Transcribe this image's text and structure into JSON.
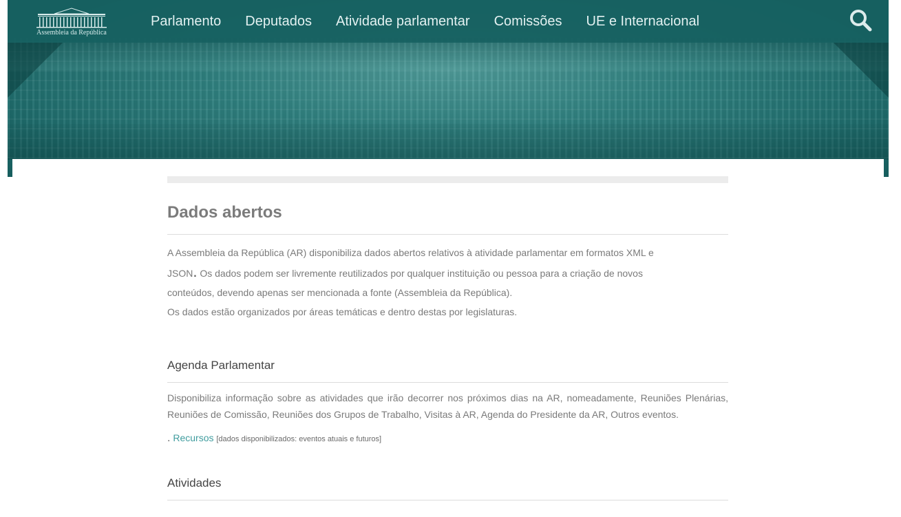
{
  "header": {
    "logo_text": "Assembleia da República",
    "nav": [
      {
        "label": "Parlamento"
      },
      {
        "label": "Deputados"
      },
      {
        "label": "Atividade parlamentar"
      },
      {
        "label": "Comissões"
      },
      {
        "label": "UE e Internacional"
      }
    ],
    "search_icon": "search-icon"
  },
  "colors": {
    "nav_bg": "#166060",
    "accent": "#3f9c9e",
    "title_grey": "#7b7b7b"
  },
  "main": {
    "title": "Dados abertos",
    "intro_line1": "A Assembleia da República (AR) disponibiliza dados abertos relativos à atividade parlamentar em formatos XML e",
    "intro_line2a": "JSON",
    "intro_dot": ".",
    "intro_line2b": " Os dados podem ser livremente reutilizados por qualquer instituição ou pessoa para a criação de novos",
    "intro_line3": "conteúdos, devendo apenas ser mencionada a fonte (Assembleia da República).",
    "intro_line4": "Os dados estão organizados por áreas temáticas e dentro destas por legislaturas.",
    "sections": [
      {
        "title": "Agenda Parlamentar",
        "text": "Disponibiliza informação sobre as atividades que irão decorrer nos próximos dias na AR, nomeadamente, Reuniões Plenárias, Reuniões de Comissão, Reuniões dos Grupos de Trabalho, Visitas à AR, Agenda do Presidente da AR, Outros eventos.",
        "bullet": ".",
        "link": "Recursos",
        "note": "[dados disponibilizados: eventos atuais e futuros]"
      },
      {
        "title": "Atividades"
      }
    ]
  }
}
